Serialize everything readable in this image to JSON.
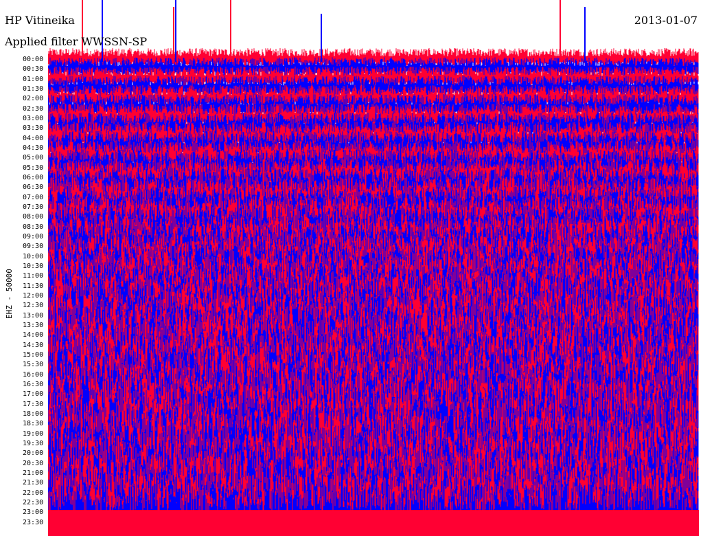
{
  "header": {
    "station": "HP Vitineika",
    "date": "2013-01-07",
    "filter": "Applied filter  WWSSN-SP"
  },
  "colors": {
    "trace_a": "#ff0033",
    "trace_b": "#0000ff"
  },
  "chart_data": {
    "type": "helicorder",
    "title": "HP Vitineika",
    "date": "2013-01-07",
    "channel_label": "EHZ - 50000",
    "hour_labels": [
      "00:00",
      "00:30",
      "01:00",
      "01:30",
      "02:00",
      "02:30",
      "03:00",
      "03:30",
      "04:00",
      "04:30",
      "05:00",
      "05:30",
      "06:00",
      "06:30",
      "07:00",
      "07:30",
      "08:00",
      "08:30",
      "09:00",
      "09:30",
      "10:00",
      "10:30",
      "11:00",
      "11:30",
      "12:00",
      "12:30",
      "13:00",
      "13:30",
      "14:00",
      "14:30",
      "15:00",
      "15:30",
      "16:00",
      "16:30",
      "17:00",
      "17:30",
      "18:00",
      "18:30",
      "19:00",
      "19:30",
      "20:00",
      "20:30",
      "21:00",
      "21:30",
      "22:00",
      "22:30",
      "23:00",
      "23:30"
    ],
    "series_colors": [
      "#ff0033",
      "#0000ff"
    ]
  }
}
